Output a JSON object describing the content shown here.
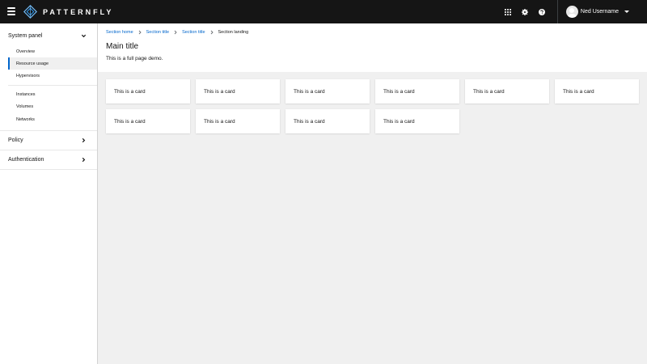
{
  "masthead": {
    "brand": "PATTERNFLY",
    "user_name": "Ned Username",
    "icons": [
      "grid-icon",
      "gear-icon",
      "help-icon",
      "chevron-down-icon"
    ]
  },
  "sidebar": {
    "groups": [
      {
        "label": "System panel",
        "expanded": true,
        "items": [
          {
            "label": "Overview"
          },
          {
            "label": "Resource usage",
            "active": true
          },
          {
            "label": "Hypervisors"
          },
          {
            "label": "Instances"
          },
          {
            "label": "Volumes"
          },
          {
            "label": "Networks"
          }
        ]
      },
      {
        "label": "Policy",
        "expanded": false
      },
      {
        "label": "Authentication",
        "expanded": false
      }
    ]
  },
  "breadcrumb": [
    {
      "label": "Section home",
      "link": true
    },
    {
      "label": "Section title",
      "link": true
    },
    {
      "label": "Section title",
      "link": true
    },
    {
      "label": "Section landing",
      "link": false
    }
  ],
  "main": {
    "title": "Main title",
    "subtitle": "This is a full page demo."
  },
  "cards": [
    "This is a card",
    "This is a card",
    "This is a card",
    "This is a card",
    "This is a card",
    "This is a card",
    "This is a card",
    "This is a card",
    "This is a card",
    "This is a card"
  ],
  "colors": {
    "masthead": "#151515",
    "link": "#0066cc",
    "active_indicator": "#0066cc",
    "page_background": "#f0f0f0"
  }
}
